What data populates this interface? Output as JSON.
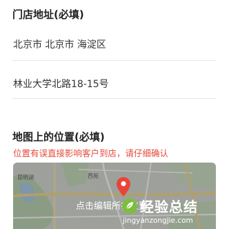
{
  "store_address": {
    "title": "门店地址(必填)",
    "region_value": "北京市 北京市 海淀区",
    "street_value": "林业大学北路18-15号"
  },
  "map_location": {
    "title": "地图上的位置(必填)",
    "warning": "位置有误直接影响客户到店，请仔细确认",
    "caption": "点击编辑所在位置",
    "labels": [
      "昆明湖",
      "西苑"
    ]
  },
  "watermark": {
    "title": "经验总结",
    "url": "jingyanzongjie.com"
  },
  "colors": {
    "warning_text": "#e64a3b",
    "pin": "#e8443a",
    "watermark_logo": "#7bbf3a"
  }
}
